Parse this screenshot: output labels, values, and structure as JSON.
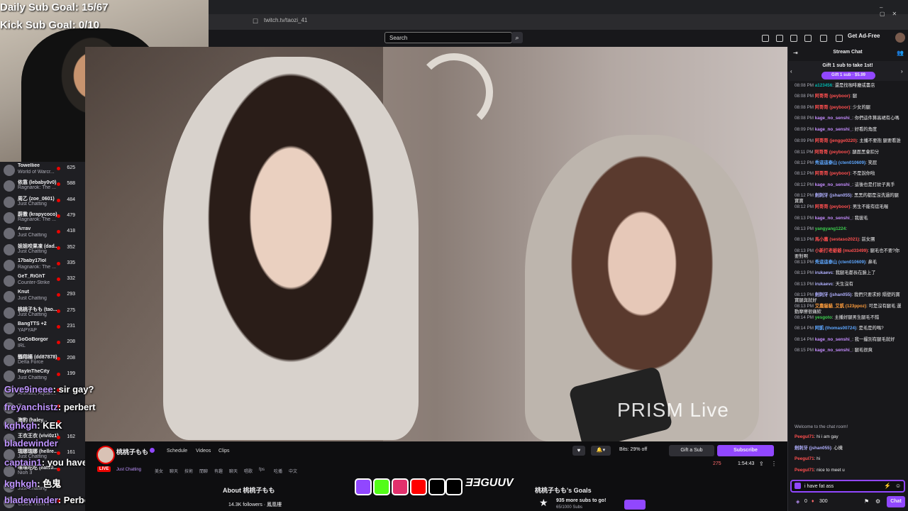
{
  "overlay": {
    "daily_goal": "Daily Sub Goal: 15/67",
    "kick_goal": "Kick Sub Goal: 0/10"
  },
  "browser": {
    "url": "twitch.tv/taozi_41",
    "search_placeholder": "Search",
    "ad_free": "Get Ad-Free"
  },
  "sidebar": {
    "channels": [
      {
        "name": "Towelliee",
        "game": "World of Warcr...",
        "viewers": "625"
      },
      {
        "name": "依靠 (lebaby0v0)",
        "game": "Ragnarok: The ...",
        "viewers": "588"
      },
      {
        "name": "周乙 (zoe_0601)",
        "game": "Just Chatting",
        "viewers": "484"
      },
      {
        "name": "蔚撒 (krapycoco)",
        "game": "Ragnarok: The ...",
        "viewers": "479"
      },
      {
        "name": "Arrav",
        "game": "Just Chatting",
        "viewers": "418"
      },
      {
        "name": "姐姐咬果凍 (dad...",
        "game": "Just Chatting",
        "viewers": "352"
      },
      {
        "name": "17baby17lol",
        "game": "Ragnarok: The ...",
        "viewers": "335"
      },
      {
        "name": "GeT_RiGhT",
        "game": "Counter-Strike",
        "viewers": "332"
      },
      {
        "name": "Knut",
        "game": "Just Chatting",
        "viewers": "293"
      },
      {
        "name": "桃桃子もも (tao...",
        "game": "Just Chatting",
        "viewers": "275"
      },
      {
        "name": "BangTTS +2",
        "game": "YAPYAP",
        "viewers": "231"
      },
      {
        "name": "GoGoBorgor",
        "game": "IRL",
        "viewers": "208"
      },
      {
        "name": "鶴翔楊 (dd87878)",
        "game": "Delta Force",
        "viewers": "208"
      },
      {
        "name": "RayInTheCity",
        "game": "Just Chatting",
        "viewers": "199"
      },
      {
        "name": "...",
        "game": "Animals, Aquari...",
        "viewers": ""
      },
      {
        "name": "...",
        "game": "",
        "viewers": ""
      },
      {
        "name": "海豹 (haley...",
        "game": "",
        "viewers": ""
      },
      {
        "name": "王衣王衣 (vivi0z1)",
        "game": "",
        "viewers": "162"
      },
      {
        "name": "瑞娜瑞娜 (hellre...",
        "game": "Just Chatting",
        "viewers": "161"
      },
      {
        "name": "咪咪吃吃 (eat10...",
        "game": "Nioh 3",
        "viewers": ""
      },
      {
        "name": "...",
        "game": "Just Chatting",
        "viewers": ""
      },
      {
        "name": "...",
        "game": "CODE VEIN II",
        "viewers": ""
      }
    ]
  },
  "overlay_chat": [
    {
      "user": "Give9ineee",
      "msg": ": sir gay?"
    },
    {
      "user": "freyanchistz",
      "msg": ": perbert"
    },
    {
      "user": "kghkgh",
      "msg": ": KEK"
    },
    {
      "user": "bladewinder",
      "msg": ""
    },
    {
      "user": "captain1",
      "msg": ": you have been knighted"
    },
    {
      "user": "kghkgh",
      "msg": ": 色鬼"
    },
    {
      "user": "bladewinder",
      "msg": ": Perbert"
    }
  ],
  "video": {
    "watermark": "PRISM Live"
  },
  "stream": {
    "channel": "桃桃子もも",
    "live": "LIVE",
    "game": "Just Chatting",
    "tags": [
      "美女",
      "聊天",
      "技術",
      "閒聊",
      "有趣",
      "聊天",
      "唱歌",
      "fps",
      "吃播",
      "中文"
    ],
    "menu_tabs": [
      "Schedule",
      "Videos",
      "Clips"
    ],
    "bits": "Bits: 29% off",
    "gift_sub": "Gift a Sub",
    "subscribe": "Subscribe",
    "viewers": "275",
    "uptime": "1:54:43",
    "about": "About 桃桃子もも",
    "followers": "14.3K followers · 鳳凰樓",
    "goals_title": "桃桃子もも's Goals",
    "goal_text": "935 more subs to go!",
    "goal_count": "65/1000 Subs"
  },
  "chat": {
    "title": "Stream Chat",
    "gift_text": "Gift 1 sub to take 1st!",
    "gift_button": "Gift 1 sub · $5.99",
    "messages": [
      {
        "time": "08:08 PM",
        "user": "a123456",
        "text": ": 還是找咖啡廳或書店",
        "color": "#00b5ad"
      },
      {
        "time": "08:08 PM",
        "user": "阿哥哥 (peyboor)",
        "text": ": 腿",
        "color": "#ff4f4f"
      },
      {
        "time": "08:08 PM",
        "user": "阿哥哥 (peyboor)",
        "text": ": 少女的腿",
        "color": "#ff4f4f"
      },
      {
        "time": "08:08 PM",
        "user": "kage_no_senshi_",
        "text": ": 你們這件算高裙有心嗎",
        "color": "#c58cff"
      },
      {
        "time": "08:09 PM",
        "user": "kage_no_senshi_",
        "text": ": 好看的角度",
        "color": "#c58cff"
      },
      {
        "time": "08:09 PM",
        "user": "阿哥哥 (jengge0220)",
        "text": ": 主播不要抱 腿要看誰",
        "color": "#ff4f4f"
      },
      {
        "time": "08:11 PM",
        "user": "阿哥哥 (peyboor)",
        "text": ": 腿面黑會扣分",
        "color": "#ff4f4f"
      },
      {
        "time": "08:12 PM",
        "user": "秀這這泰山 (cten010609)",
        "text": ": 笑屁",
        "color": "#5ea7ff"
      },
      {
        "time": "08:12 PM",
        "user": "阿哥哥 (peyboor)",
        "text": ": 不是說你啦",
        "color": "#ff4f4f"
      },
      {
        "time": "08:12 PM",
        "user": "kage_no_senshi_",
        "text": ": 這後也是打紋子真手",
        "color": "#c58cff"
      },
      {
        "time": "08:12 PM",
        "user": "劍刺牙 (jshan055)",
        "text": ": 黑黑的都是沒洗過的腿寶寶",
        "color": "#b0b0ff"
      },
      {
        "time": "08:12 PM",
        "user": "阿哥哥 (peyboor)",
        "text": ": 男生不能有痣毛喔",
        "color": "#ff4f4f"
      },
      {
        "time": "08:13 PM",
        "user": "kage_no_senshi_",
        "text": ": 我拔毛",
        "color": "#c58cff"
      },
      {
        "time": "08:13 PM",
        "user": "yangyang1224",
        "text": ":",
        "color": "#3ccf4e"
      },
      {
        "time": "08:13 PM",
        "user": "馬小嘉 (sestaso2021)",
        "text": ": 前女團",
        "color": "#ff4f4f"
      },
      {
        "time": "08:13 PM",
        "user": "小新打老爺爺 (mud33499)",
        "text": ": 腿毛也不要?你要對啊",
        "color": "#ff4f4f"
      },
      {
        "time": "08:13 PM",
        "user": "秀這這泰山 (cten010609)",
        "text": ": 鼻毛",
        "color": "#5ea7ff"
      },
      {
        "time": "08:13 PM",
        "user": "irukaevc",
        "text": ": 我腿毛都長在臉上了",
        "color": "#b0b0ff"
      },
      {
        "time": "08:13 PM",
        "user": "irukaevc",
        "text": ": 天生沒有",
        "color": "#b0b0ff"
      },
      {
        "time": "08:13 PM",
        "user": "劍刺牙 (jshan055)",
        "text": ": 我們只要求妳 隔壁的寶寶腿與就好",
        "color": "#b0b0ff"
      },
      {
        "time": "08:13 PM",
        "user": "艾農貓貓_艾凱 (123ppoz)",
        "text": ": 可是沒有腿毛 運動摩擦很痛欸",
        "color": "#ff9d3c"
      },
      {
        "time": "08:14 PM",
        "user": "yesgoto",
        "text": ": 主播好腿男生腿毛不錯",
        "color": "#3ccf4e"
      },
      {
        "time": "08:14 PM",
        "user": "阿凱 (thomas00724)",
        "text": ": 是毛是的嗎?",
        "color": "#5ea7ff"
      },
      {
        "time": "08:14 PM",
        "user": "kage_no_senshi_",
        "text": ": 我一撮別有腿毛就好",
        "color": "#c58cff"
      },
      {
        "time": "08:15 PM",
        "user": "kage_no_senshi_",
        "text": ": 腿毛很爽",
        "color": "#c58cff"
      }
    ],
    "welcome": "Welcome to the chat room!",
    "recent": [
      {
        "user": "Peegul71",
        "text": ": hi i am gay",
        "color": "#ff4f4f"
      },
      {
        "user": "劍刺牙 (jshan055)",
        "text": ": 心機",
        "color": "#b0b0ff"
      },
      {
        "user": "Peegul71",
        "text": ": hi",
        "color": "#ff4f4f"
      },
      {
        "user": "Peegul71",
        "text": ": nice to meet u",
        "color": "#ff4f4f"
      }
    ],
    "input_value": "i have fat ass",
    "points": "0",
    "points2": "300",
    "chat_button": "Chat"
  }
}
